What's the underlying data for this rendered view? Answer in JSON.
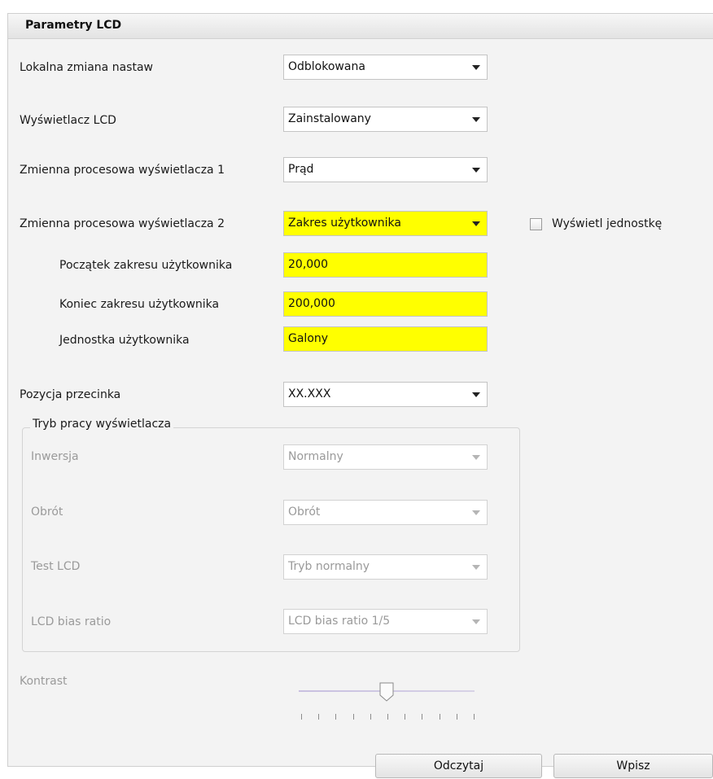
{
  "panel": {
    "title": "Parametry LCD"
  },
  "fields": {
    "local_change": {
      "label": "Lokalna zmiana nastaw",
      "value": "Odblokowana"
    },
    "lcd_display": {
      "label": "Wyświetlacz LCD",
      "value": "Zainstalowany"
    },
    "pv1": {
      "label": "Zmienna procesowa wyświetlacza 1",
      "value": "Prąd"
    },
    "pv2": {
      "label": "Zmienna procesowa wyświetlacza 2",
      "value": "Zakres użytkownika"
    },
    "range_start": {
      "label": "Początek zakresu użytkownika",
      "value": "20,000"
    },
    "range_end": {
      "label": "Koniec zakresu użytkownika",
      "value": "200,000"
    },
    "user_unit": {
      "label": "Jednostka użytkownika",
      "value": "Galony"
    },
    "decimal_pos": {
      "label": "Pozycja przecinka",
      "value": "XX.XXX"
    }
  },
  "show_unit": {
    "label": "Wyświetl jednostkę",
    "checked": false
  },
  "display_mode": {
    "legend": "Tryb pracy wyświetlacza",
    "inversion": {
      "label": "Inwersja",
      "value": "Normalny"
    },
    "rotation": {
      "label": "Obrót",
      "value": "Obrót"
    },
    "lcd_test": {
      "label": "Test LCD",
      "value": "Tryb normalny"
    },
    "bias": {
      "label": "LCD bias ratio",
      "value": "LCD bias ratio 1/5"
    }
  },
  "contrast": {
    "label": "Kontrast",
    "value_fraction": 0.5,
    "tick_count": 11
  },
  "buttons": {
    "read": "Odczytaj",
    "write": "Wpisz"
  },
  "colors": {
    "highlight": "#ffff00"
  }
}
